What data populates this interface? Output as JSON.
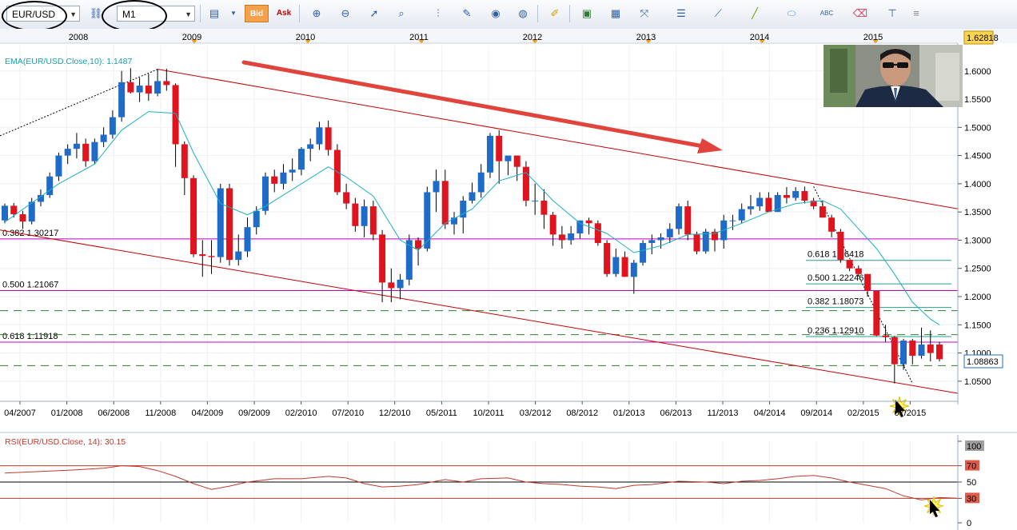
{
  "toolbar": {
    "symbol": "EUR/USD",
    "timeframe": "M1",
    "bid_label": "Bid",
    "ask_label": "Ask",
    "icons": [
      "bar-chart-icon",
      "zoom-in-icon",
      "zoom-out-icon",
      "cursor-icon",
      "crosshair-icon",
      "period-separator-icon",
      "edit-icon",
      "eye-icon",
      "globe-icon",
      "ruler-icon",
      "image-icon",
      "template-icon",
      "arrows-icon",
      "horizontal-lines-icon",
      "fan-icon",
      "trendline-icon",
      "ellipse-icon",
      "text-icon",
      "eraser-icon",
      "tree-icon",
      "menu-icon"
    ]
  },
  "colors": {
    "bull": "#1e6bc8",
    "bear": "#e0141e",
    "ema": "#1ab0c0",
    "channel": "#c80000",
    "fib_magenta": "#c000c0",
    "fib_teal": "#2a9d8f",
    "dashed_green": "#2e7d32",
    "rsi": "#c0392b",
    "price_box_high": "#ffd54f",
    "price_box_current": "#ffffff",
    "arrow": "#e0443a"
  },
  "chart_data": [
    {
      "type": "candlestick",
      "title": "EUR/USD",
      "indicator_label": "EMA(EUR/USD.Close,10): 1.1487",
      "x_tick_labels": [
        "04/2007",
        "01/2008",
        "06/2008",
        "11/2008",
        "04/2009",
        "09/2009",
        "02/2010",
        "07/2010",
        "12/2010",
        "05/2011",
        "10/2011",
        "03/2012",
        "08/2012",
        "01/2013",
        "06/2013",
        "11/2013",
        "04/2014",
        "09/2014",
        "02/2015",
        "07/2015"
      ],
      "year_labels": [
        "2008",
        "2009",
        "2010",
        "2011",
        "2012",
        "2013",
        "2014",
        "2015"
      ],
      "y_ticks": [
        1.05,
        1.1,
        1.15,
        1.2,
        1.25,
        1.3,
        1.35,
        1.4,
        1.45,
        1.5,
        1.55,
        1.6
      ],
      "y_tick_labels": [
        "1.0500",
        "1.1000",
        "1.1500",
        "1.2000",
        "1.2500",
        "1.3000",
        "1.3500",
        "1.4000",
        "1.4500",
        "1.5000",
        "1.5500",
        "1.6000"
      ],
      "ylim": [
        1.02,
        1.645
      ],
      "price_high_label": "1.62818",
      "price_current_label": "1.08863",
      "candles": [
        {
          "o": 1.335,
          "h": 1.365,
          "l": 1.33,
          "c": 1.361
        },
        {
          "o": 1.361,
          "h": 1.366,
          "l": 1.34,
          "c": 1.346
        },
        {
          "o": 1.346,
          "h": 1.352,
          "l": 1.32,
          "c": 1.333
        },
        {
          "o": 1.333,
          "h": 1.375,
          "l": 1.328,
          "c": 1.368
        },
        {
          "o": 1.368,
          "h": 1.39,
          "l": 1.36,
          "c": 1.38
        },
        {
          "o": 1.38,
          "h": 1.42,
          "l": 1.375,
          "c": 1.413
        },
        {
          "o": 1.413,
          "h": 1.455,
          "l": 1.405,
          "c": 1.45
        },
        {
          "o": 1.45,
          "h": 1.47,
          "l": 1.435,
          "c": 1.462
        },
        {
          "o": 1.462,
          "h": 1.49,
          "l": 1.445,
          "c": 1.471
        },
        {
          "o": 1.471,
          "h": 1.48,
          "l": 1.43,
          "c": 1.44
        },
        {
          "o": 1.44,
          "h": 1.48,
          "l": 1.435,
          "c": 1.474
        },
        {
          "o": 1.474,
          "h": 1.5,
          "l": 1.465,
          "c": 1.487
        },
        {
          "o": 1.487,
          "h": 1.53,
          "l": 1.48,
          "c": 1.518
        },
        {
          "o": 1.518,
          "h": 1.6,
          "l": 1.51,
          "c": 1.58
        },
        {
          "o": 1.58,
          "h": 1.605,
          "l": 1.56,
          "c": 1.562
        },
        {
          "o": 1.562,
          "h": 1.588,
          "l": 1.545,
          "c": 1.574
        },
        {
          "o": 1.574,
          "h": 1.595,
          "l": 1.547,
          "c": 1.56
        },
        {
          "o": 1.56,
          "h": 1.603,
          "l": 1.555,
          "c": 1.582
        },
        {
          "o": 1.582,
          "h": 1.604,
          "l": 1.565,
          "c": 1.575
        },
        {
          "o": 1.575,
          "h": 1.578,
          "l": 1.43,
          "c": 1.47
        },
        {
          "o": 1.47,
          "h": 1.475,
          "l": 1.38,
          "c": 1.41
        },
        {
          "o": 1.41,
          "h": 1.415,
          "l": 1.27,
          "c": 1.275
        },
        {
          "o": 1.275,
          "h": 1.3,
          "l": 1.235,
          "c": 1.272
        },
        {
          "o": 1.272,
          "h": 1.3,
          "l": 1.24,
          "c": 1.27
        },
        {
          "o": 1.27,
          "h": 1.4,
          "l": 1.26,
          "c": 1.392
        },
        {
          "o": 1.392,
          "h": 1.4,
          "l": 1.255,
          "c": 1.265
        },
        {
          "o": 1.265,
          "h": 1.31,
          "l": 1.255,
          "c": 1.28
        },
        {
          "o": 1.28,
          "h": 1.34,
          "l": 1.27,
          "c": 1.323
        },
        {
          "o": 1.323,
          "h": 1.36,
          "l": 1.31,
          "c": 1.352
        },
        {
          "o": 1.352,
          "h": 1.42,
          "l": 1.345,
          "c": 1.413
        },
        {
          "o": 1.413,
          "h": 1.425,
          "l": 1.385,
          "c": 1.4
        },
        {
          "o": 1.4,
          "h": 1.435,
          "l": 1.39,
          "c": 1.42
        },
        {
          "o": 1.42,
          "h": 1.445,
          "l": 1.405,
          "c": 1.425
        },
        {
          "o": 1.425,
          "h": 1.465,
          "l": 1.415,
          "c": 1.462
        },
        {
          "o": 1.462,
          "h": 1.48,
          "l": 1.44,
          "c": 1.47
        },
        {
          "o": 1.47,
          "h": 1.51,
          "l": 1.46,
          "c": 1.5
        },
        {
          "o": 1.5,
          "h": 1.512,
          "l": 1.45,
          "c": 1.46
        },
        {
          "o": 1.46,
          "h": 1.47,
          "l": 1.38,
          "c": 1.385
        },
        {
          "o": 1.385,
          "h": 1.4,
          "l": 1.355,
          "c": 1.365
        },
        {
          "o": 1.365,
          "h": 1.375,
          "l": 1.315,
          "c": 1.325
        },
        {
          "o": 1.325,
          "h": 1.372,
          "l": 1.305,
          "c": 1.36
        },
        {
          "o": 1.36,
          "h": 1.37,
          "l": 1.3,
          "c": 1.31
        },
        {
          "o": 1.31,
          "h": 1.318,
          "l": 1.19,
          "c": 1.225
        },
        {
          "o": 1.225,
          "h": 1.25,
          "l": 1.19,
          "c": 1.215
        },
        {
          "o": 1.215,
          "h": 1.24,
          "l": 1.195,
          "c": 1.23
        },
        {
          "o": 1.23,
          "h": 1.31,
          "l": 1.22,
          "c": 1.3
        },
        {
          "o": 1.3,
          "h": 1.305,
          "l": 1.255,
          "c": 1.285
        },
        {
          "o": 1.285,
          "h": 1.395,
          "l": 1.28,
          "c": 1.385
        },
        {
          "o": 1.385,
          "h": 1.425,
          "l": 1.35,
          "c": 1.405
        },
        {
          "o": 1.405,
          "h": 1.425,
          "l": 1.32,
          "c": 1.328
        },
        {
          "o": 1.328,
          "h": 1.35,
          "l": 1.31,
          "c": 1.34
        },
        {
          "o": 1.34,
          "h": 1.378,
          "l": 1.312,
          "c": 1.37
        },
        {
          "o": 1.37,
          "h": 1.402,
          "l": 1.365,
          "c": 1.385
        },
        {
          "o": 1.385,
          "h": 1.435,
          "l": 1.375,
          "c": 1.42
        },
        {
          "o": 1.42,
          "h": 1.49,
          "l": 1.41,
          "c": 1.485
        },
        {
          "o": 1.485,
          "h": 1.495,
          "l": 1.4,
          "c": 1.44
        },
        {
          "o": 1.44,
          "h": 1.45,
          "l": 1.415,
          "c": 1.45
        },
        {
          "o": 1.45,
          "h": 1.45,
          "l": 1.405,
          "c": 1.43
        },
        {
          "o": 1.43,
          "h": 1.44,
          "l": 1.36,
          "c": 1.37
        },
        {
          "o": 1.37,
          "h": 1.4,
          "l": 1.345,
          "c": 1.37
        },
        {
          "o": 1.37,
          "h": 1.39,
          "l": 1.32,
          "c": 1.345
        },
        {
          "o": 1.345,
          "h": 1.35,
          "l": 1.29,
          "c": 1.31
        },
        {
          "o": 1.31,
          "h": 1.325,
          "l": 1.285,
          "c": 1.3
        },
        {
          "o": 1.3,
          "h": 1.325,
          "l": 1.292,
          "c": 1.312
        },
        {
          "o": 1.312,
          "h": 1.335,
          "l": 1.303,
          "c": 1.335
        },
        {
          "o": 1.335,
          "h": 1.34,
          "l": 1.31,
          "c": 1.33
        },
        {
          "o": 1.33,
          "h": 1.335,
          "l": 1.29,
          "c": 1.295
        },
        {
          "o": 1.295,
          "h": 1.3,
          "l": 1.235,
          "c": 1.24
        },
        {
          "o": 1.24,
          "h": 1.285,
          "l": 1.235,
          "c": 1.27
        },
        {
          "o": 1.27,
          "h": 1.28,
          "l": 1.235,
          "c": 1.235
        },
        {
          "o": 1.235,
          "h": 1.265,
          "l": 1.205,
          "c": 1.26
        },
        {
          "o": 1.26,
          "h": 1.3,
          "l": 1.255,
          "c": 1.295
        },
        {
          "o": 1.295,
          "h": 1.31,
          "l": 1.275,
          "c": 1.3
        },
        {
          "o": 1.3,
          "h": 1.312,
          "l": 1.285,
          "c": 1.305
        },
        {
          "o": 1.305,
          "h": 1.33,
          "l": 1.295,
          "c": 1.32
        },
        {
          "o": 1.32,
          "h": 1.365,
          "l": 1.31,
          "c": 1.36
        },
        {
          "o": 1.36,
          "h": 1.37,
          "l": 1.3,
          "c": 1.31
        },
        {
          "o": 1.31,
          "h": 1.315,
          "l": 1.275,
          "c": 1.28
        },
        {
          "o": 1.28,
          "h": 1.32,
          "l": 1.276,
          "c": 1.315
        },
        {
          "o": 1.315,
          "h": 1.32,
          "l": 1.28,
          "c": 1.3
        },
        {
          "o": 1.3,
          "h": 1.345,
          "l": 1.285,
          "c": 1.335
        },
        {
          "o": 1.335,
          "h": 1.345,
          "l": 1.318,
          "c": 1.335
        },
        {
          "o": 1.335,
          "h": 1.365,
          "l": 1.33,
          "c": 1.355
        },
        {
          "o": 1.355,
          "h": 1.38,
          "l": 1.345,
          "c": 1.36
        },
        {
          "o": 1.36,
          "h": 1.385,
          "l": 1.352,
          "c": 1.375
        },
        {
          "o": 1.375,
          "h": 1.385,
          "l": 1.35,
          "c": 1.35
        },
        {
          "o": 1.35,
          "h": 1.385,
          "l": 1.35,
          "c": 1.38
        },
        {
          "o": 1.38,
          "h": 1.394,
          "l": 1.365,
          "c": 1.375
        },
        {
          "o": 1.375,
          "h": 1.394,
          "l": 1.37,
          "c": 1.387
        },
        {
          "o": 1.387,
          "h": 1.395,
          "l": 1.365,
          "c": 1.37
        },
        {
          "o": 1.37,
          "h": 1.375,
          "l": 1.355,
          "c": 1.36
        },
        {
          "o": 1.36,
          "h": 1.37,
          "l": 1.34,
          "c": 1.34
        },
        {
          "o": 1.34,
          "h": 1.345,
          "l": 1.305,
          "c": 1.315
        },
        {
          "o": 1.315,
          "h": 1.32,
          "l": 1.26,
          "c": 1.265
        },
        {
          "o": 1.265,
          "h": 1.265,
          "l": 1.245,
          "c": 1.25
        },
        {
          "o": 1.25,
          "h": 1.255,
          "l": 1.235,
          "c": 1.24
        },
        {
          "o": 1.24,
          "h": 1.24,
          "l": 1.2,
          "c": 1.21
        },
        {
          "o": 1.21,
          "h": 1.21,
          "l": 1.13,
          "c": 1.131
        },
        {
          "o": 1.131,
          "h": 1.15,
          "l": 1.12,
          "c": 1.128
        },
        {
          "o": 1.128,
          "h": 1.13,
          "l": 1.046,
          "c": 1.08
        },
        {
          "o": 1.08,
          "h": 1.125,
          "l": 1.07,
          "c": 1.122
        },
        {
          "o": 1.122,
          "h": 1.125,
          "l": 1.08,
          "c": 1.095
        },
        {
          "o": 1.095,
          "h": 1.145,
          "l": 1.09,
          "c": 1.115
        },
        {
          "o": 1.115,
          "h": 1.14,
          "l": 1.085,
          "c": 1.1
        },
        {
          "o": 1.115,
          "h": 1.12,
          "l": 1.085,
          "c": 1.089
        }
      ],
      "ema": [
        [
          0,
          1.332
        ],
        [
          6,
          1.4
        ],
        [
          10,
          1.435
        ],
        [
          13,
          1.495
        ],
        [
          16,
          1.528
        ],
        [
          19,
          1.525
        ],
        [
          21,
          1.455
        ],
        [
          24,
          1.365
        ],
        [
          27,
          1.345
        ],
        [
          29,
          1.36
        ],
        [
          32,
          1.39
        ],
        [
          36,
          1.43
        ],
        [
          38,
          1.412
        ],
        [
          41,
          1.378
        ],
        [
          44,
          1.3
        ],
        [
          46,
          1.282
        ],
        [
          49,
          1.33
        ],
        [
          52,
          1.355
        ],
        [
          55,
          1.405
        ],
        [
          58,
          1.42
        ],
        [
          61,
          1.37
        ],
        [
          64,
          1.33
        ],
        [
          67,
          1.312
        ],
        [
          70,
          1.278
        ],
        [
          73,
          1.29
        ],
        [
          76,
          1.31
        ],
        [
          79,
          1.312
        ],
        [
          82,
          1.33
        ],
        [
          85,
          1.35
        ],
        [
          88,
          1.365
        ],
        [
          91,
          1.37
        ],
        [
          93,
          1.355
        ],
        [
          95,
          1.32
        ],
        [
          97,
          1.285
        ],
        [
          99,
          1.24
        ],
        [
          101,
          1.19
        ],
        [
          103,
          1.16
        ],
        [
          104,
          1.15
        ]
      ],
      "fib_horizontal": [
        {
          "label": "0.382 1.30217",
          "value": 1.30217,
          "color": "#c000c0"
        },
        {
          "label": "0.500 1.21067",
          "value": 1.21067,
          "color": "#c000c0"
        },
        {
          "label": "0.618 1.11918",
          "value": 1.11918,
          "color": "#c000c0"
        }
      ],
      "fib_retrace": [
        {
          "label": "0.618 1.26418",
          "value": 1.26418
        },
        {
          "label": "0.500 1.22246",
          "value": 1.22246
        },
        {
          "label": "0.382 1.18073",
          "value": 1.18073
        },
        {
          "label": "0.236 1.12910",
          "value": 1.1291
        }
      ],
      "dashed_levels": [
        1.175,
        1.1325,
        1.0775
      ],
      "channel": {
        "upper": [
          [
            17,
            1.603
          ],
          [
            106,
            1.352
          ]
        ],
        "lower": [
          [
            0,
            1.318
          ],
          [
            106,
            1.025
          ]
        ]
      }
    },
    {
      "type": "line",
      "indicator_label": "RSI(EUR/USD.Close, 14): 30.15",
      "y_ticks": [
        0,
        30,
        50,
        70,
        100
      ],
      "y_tick_labels": [
        "0",
        "30",
        "50",
        "70",
        "100"
      ],
      "ylim": [
        0,
        100
      ],
      "levels": [
        70,
        50,
        30
      ],
      "values": [
        [
          0,
          61
        ],
        [
          4,
          63
        ],
        [
          8,
          65
        ],
        [
          11,
          67
        ],
        [
          13,
          70
        ],
        [
          15,
          69
        ],
        [
          17,
          64
        ],
        [
          19,
          57
        ],
        [
          21,
          48
        ],
        [
          23,
          41
        ],
        [
          25,
          45
        ],
        [
          27,
          50
        ],
        [
          30,
          54
        ],
        [
          33,
          54
        ],
        [
          36,
          57
        ],
        [
          38,
          55
        ],
        [
          40,
          48
        ],
        [
          42,
          44
        ],
        [
          44,
          45
        ],
        [
          46,
          47
        ],
        [
          49,
          53
        ],
        [
          51,
          50
        ],
        [
          53,
          54
        ],
        [
          56,
          55
        ],
        [
          58,
          50
        ],
        [
          60,
          48
        ],
        [
          62,
          47
        ],
        [
          64,
          45
        ],
        [
          66,
          44
        ],
        [
          68,
          42
        ],
        [
          70,
          46
        ],
        [
          72,
          47
        ],
        [
          75,
          51
        ],
        [
          78,
          50
        ],
        [
          80,
          48
        ],
        [
          82,
          51
        ],
        [
          84,
          52
        ],
        [
          86,
          54
        ],
        [
          88,
          57
        ],
        [
          90,
          58
        ],
        [
          92,
          55
        ],
        [
          94,
          50
        ],
        [
          96,
          46
        ],
        [
          98,
          42
        ],
        [
          100,
          33
        ],
        [
          102,
          28
        ],
        [
          104,
          31
        ],
        [
          106,
          30.15
        ]
      ]
    }
  ]
}
